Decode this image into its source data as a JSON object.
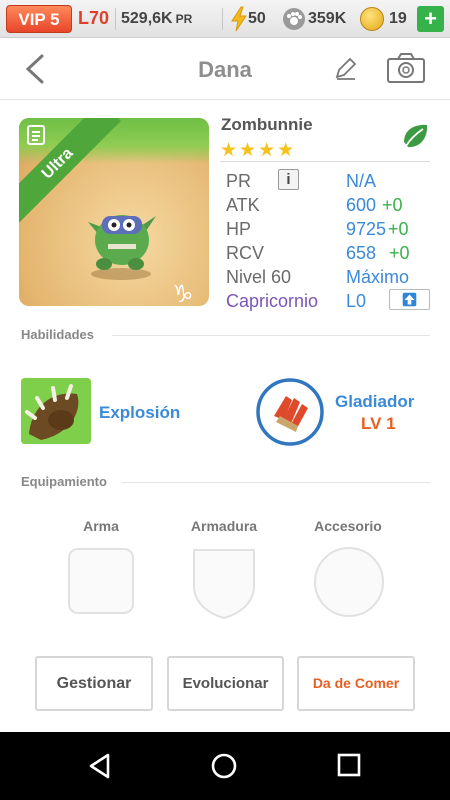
{
  "status": {
    "vip": "VIP 5",
    "level": "L70",
    "power": "529,6K",
    "power_unit": "PR",
    "energy": "50",
    "paw": "359K",
    "coins": "19",
    "plus": "+"
  },
  "header": {
    "title": "Dana"
  },
  "card": {
    "rarity": "Ultra"
  },
  "monster": {
    "name": "Zombunnie",
    "stars": "★★★★",
    "element": "leaf-icon",
    "stats": [
      {
        "label": "PR",
        "value": "N/A",
        "bonus": ""
      },
      {
        "label": "ATK",
        "value": "600",
        "bonus": "+0"
      },
      {
        "label": "HP",
        "value": "9725",
        "bonus": "+0"
      },
      {
        "label": "RCV",
        "value": "658",
        "bonus": "+0"
      },
      {
        "label": "Nivel 60",
        "value": "Máximo",
        "bonus": ""
      },
      {
        "label": "Capricornio",
        "value": "L0",
        "bonus": ""
      }
    ]
  },
  "skills": {
    "title": "Habilidades",
    "active": {
      "name": "Explosión"
    },
    "passive": {
      "name": "Gladiador",
      "level": "LV 1"
    }
  },
  "equipment": {
    "title": "Equipamiento",
    "weapon": "Arma",
    "armor": "Armadura",
    "accessory": "Accesorio"
  },
  "buttons": {
    "manage": "Gestionar",
    "evolve": "Evolucionar",
    "feed": "Da de Comer"
  },
  "colors": {
    "accent_blue": "#3b8ad9",
    "bonus_green": "#3bb24a",
    "orange": "#e85f22",
    "vip_red": "#e8452a"
  }
}
